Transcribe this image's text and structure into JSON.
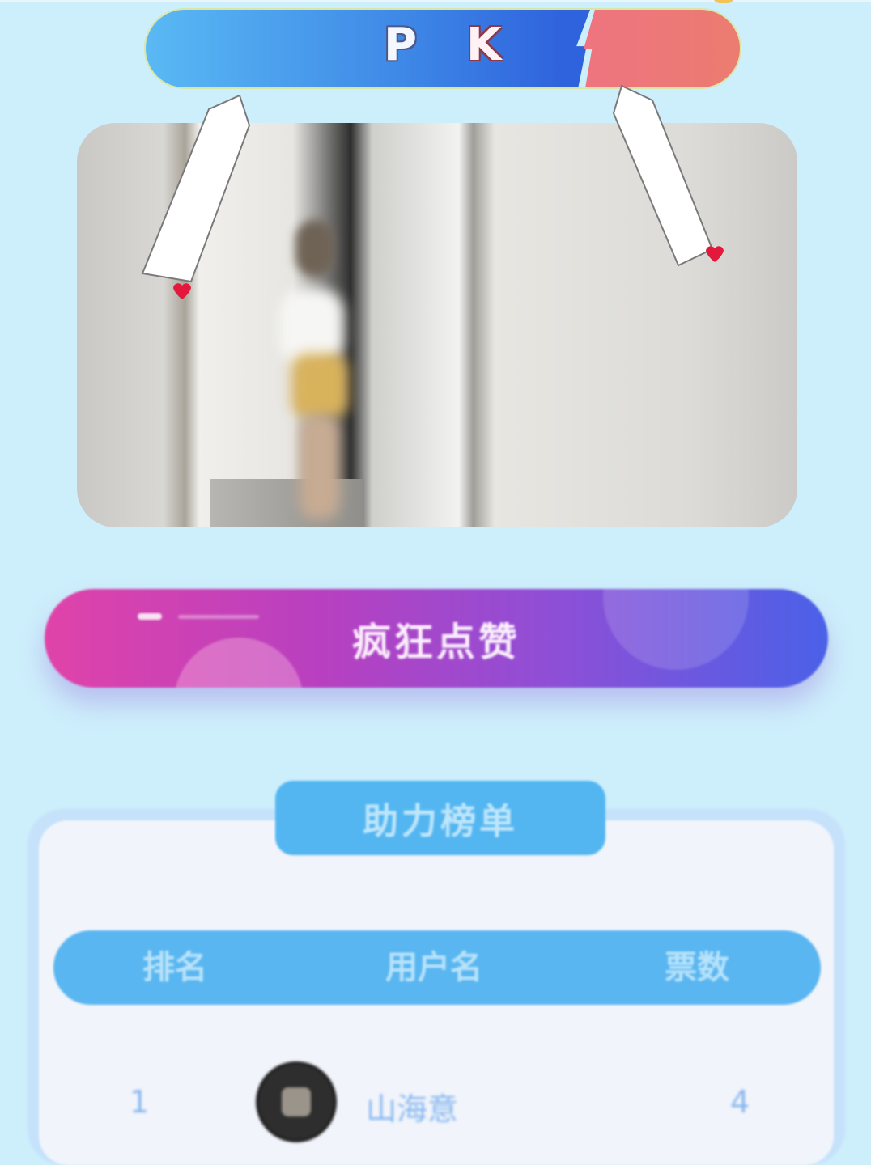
{
  "pk_bar": {
    "left_letter": "P",
    "right_letter": "K",
    "left_color": "#3d86e6",
    "right_color": "#ef6e8b"
  },
  "photo": {
    "icon": "blurred-photo"
  },
  "like_button": {
    "label": "疯狂点赞",
    "gradient_start": "#e043a9",
    "gradient_end": "#4a61e8"
  },
  "leaderboard": {
    "title": "助力榜单",
    "columns": [
      "排名",
      "用户名",
      "票数"
    ],
    "rows": [
      {
        "rank": "1",
        "username": "山海意",
        "votes": "4",
        "avatar_icon": "user-avatar"
      }
    ]
  },
  "accent_colors": {
    "background": "#cdeefb",
    "tab": "#54b6f1",
    "marker": "#e3183c"
  }
}
